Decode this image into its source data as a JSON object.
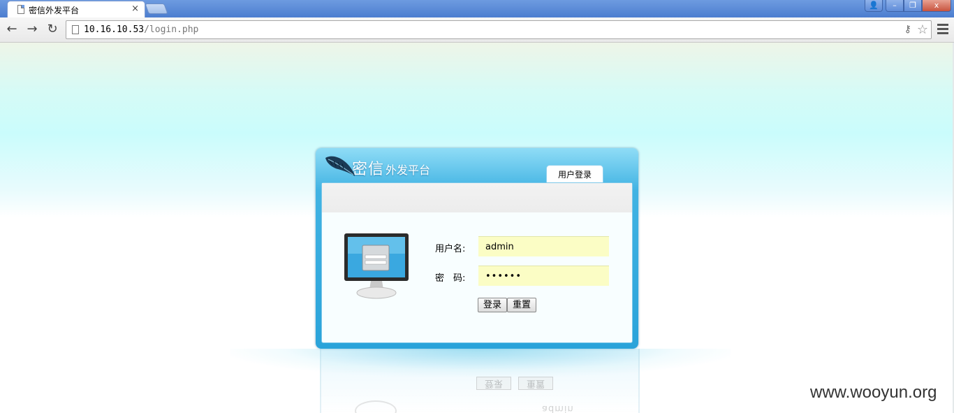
{
  "browser": {
    "tab_title": "密信外发平台",
    "tab_close": "×",
    "url_host": "10.16.10.53",
    "url_path": "/login.php",
    "window_buttons": {
      "user": "👤",
      "minimize": "–",
      "maximize": "❐",
      "close": "x"
    },
    "nav": {
      "back": "←",
      "forward": "→",
      "reload": "↻"
    },
    "icons": {
      "key": "⚷",
      "star": "☆"
    }
  },
  "login": {
    "brand_main": "密信",
    "brand_sub": "外发平台",
    "tab_label": "用户登录",
    "username_label": "用户名:",
    "password_label": "密　码:",
    "username_value": "admin",
    "password_value": "••••••",
    "login_button": "登录",
    "reset_button": "重置"
  },
  "reflection": {
    "login_button": "登录",
    "reset_button": "重置",
    "ghost_text": "admin"
  },
  "watermark": "www.wooyun.org",
  "colors": {
    "titlebar": "#4c7dcf",
    "panel_blue": "#2aa3da",
    "field_yellow": "#fbfdc5"
  }
}
